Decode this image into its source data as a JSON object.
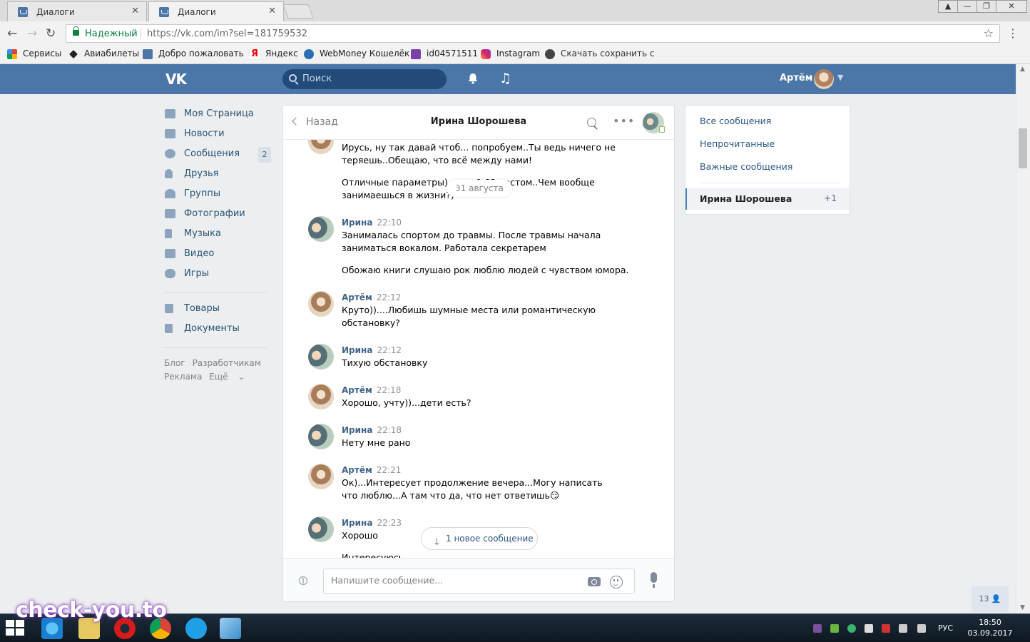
{
  "browser": {
    "tabs": [
      {
        "title": "Диалоги",
        "active": false
      },
      {
        "title": "Диалоги",
        "active": true
      }
    ],
    "secure_label": "Надежный",
    "url": "https://vk.com/im?sel=181759532",
    "bookmarks": [
      "Сервисы",
      "Авиабилеты",
      "Добро пожаловать",
      "Яндекс",
      "WebMoney Кошелёк",
      "id04571511",
      "Instagram",
      "Скачать сохранить с"
    ]
  },
  "vk": {
    "brand_color": "#4a76a8",
    "search_placeholder": "Поиск",
    "user_name": "Артём"
  },
  "nav": {
    "items": [
      {
        "label": "Моя Страница",
        "icon": "home-icon"
      },
      {
        "label": "Новости",
        "icon": "news-icon"
      },
      {
        "label": "Сообщения",
        "icon": "messages-icon",
        "badge": "2"
      },
      {
        "label": "Друзья",
        "icon": "friends-icon"
      },
      {
        "label": "Группы",
        "icon": "groups-icon"
      },
      {
        "label": "Фотографии",
        "icon": "photos-icon"
      },
      {
        "label": "Музыка",
        "icon": "music-icon"
      },
      {
        "label": "Видео",
        "icon": "video-icon"
      },
      {
        "label": "Игры",
        "icon": "games-icon"
      },
      {
        "label": "Товары",
        "icon": "goods-icon"
      },
      {
        "label": "Документы",
        "icon": "documents-icon"
      }
    ],
    "footer": {
      "blog": "Блог",
      "developers": "Разработчикам",
      "ads": "Реклама",
      "more": "Ещё"
    }
  },
  "chat": {
    "back_label": "Назад",
    "title": "Ирина Шорошева",
    "date_chip": "31 августа",
    "messages": [
      {
        "author": "",
        "time": "",
        "lines": [
          "Ирусь, ну так давай чтоб... попробуем..Ты ведь ничего не теряешь..Обещаю, что всё между нами!",
          "Отличные параметры)...сам 1.82 ростом..Чем вообще занимаешься в жизни?)"
        ]
      },
      {
        "author": "Ирина",
        "time": "22:10",
        "lines": [
          "Занималась спортом до травмы. После травмы начала заниматься вокалом. Работала секретарем",
          "Обожаю книги слушаю рок люблю людей с чувством юмора."
        ]
      },
      {
        "author": "Артём",
        "time": "22:12",
        "lines": [
          "Круто))....Любишь шумные места или романтическую обстановку?"
        ]
      },
      {
        "author": "Ирина",
        "time": "22:12",
        "lines": [
          "Тихую обстановку"
        ]
      },
      {
        "author": "Артём",
        "time": "22:18",
        "lines": [
          "Хорошо, учту))...дети есть?"
        ]
      },
      {
        "author": "Ирина",
        "time": "22:18",
        "lines": [
          "Нету мне рано"
        ]
      },
      {
        "author": "Артём",
        "time": "22:21",
        "lines": [
          "Ок)...Интересует продолжение вечера...Могу написать что люблю...А там что да, что нет ответишь😏"
        ]
      },
      {
        "author": "Ирина",
        "time": "22:23",
        "lines": [
          "Хорошо",
          "Интересуюсь"
        ]
      }
    ],
    "new_message_label": "1 новое сообщение",
    "input_placeholder": "Напишите сообщение..."
  },
  "filters": {
    "all": "Все сообщения",
    "unread": "Непрочитанные",
    "important": "Важные сообщения",
    "active_dialog": "Ирина Шорошева",
    "active_count": "+1"
  },
  "online_count": "13",
  "taskbar": {
    "lang": "РУС",
    "time": "18:50",
    "date": "03.09.2017"
  },
  "watermark": "check-you.to"
}
